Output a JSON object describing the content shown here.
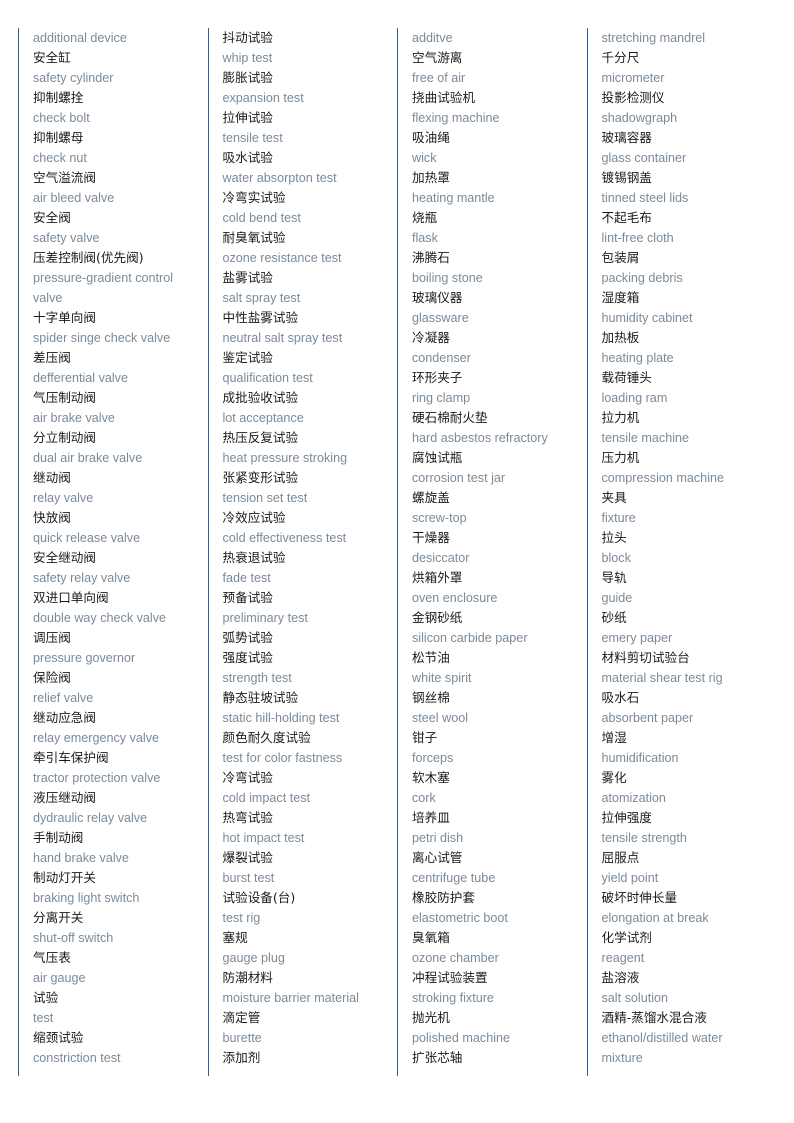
{
  "document": {
    "type": "bilingual-glossary",
    "title": "Automotive brake components and test equipment glossary",
    "language_pair": "Chinese-English",
    "column_count": 4,
    "colors": {
      "chinese_text": "#1a1a1a",
      "english_text": "#7b8a99",
      "column_rule": "#2a63a5",
      "background": "#ffffff"
    }
  },
  "columns": [
    {
      "index": 1,
      "lines": [
        {
          "lang": "en",
          "text": "additional device"
        },
        {
          "lang": "zh",
          "text": "安全缸"
        },
        {
          "lang": "en",
          "text": "safety cylinder"
        },
        {
          "lang": "zh",
          "text": "抑制螺拴"
        },
        {
          "lang": "en",
          "text": "check bolt"
        },
        {
          "lang": "zh",
          "text": "抑制螺母"
        },
        {
          "lang": "en",
          "text": "check nut"
        },
        {
          "lang": "zh",
          "text": "空气溢流阀"
        },
        {
          "lang": "en",
          "text": "air bleed valve"
        },
        {
          "lang": "zh",
          "text": "安全阀"
        },
        {
          "lang": "en",
          "text": "safety valve"
        },
        {
          "lang": "zh",
          "text": "压差控制阀(优先阀)"
        },
        {
          "lang": "en",
          "text": "pressure-gradient control"
        },
        {
          "lang": "en",
          "text": "valve"
        },
        {
          "lang": "zh",
          "text": "十字单向阀"
        },
        {
          "lang": "en",
          "text": "spider singe check valve"
        },
        {
          "lang": "zh",
          "text": "差压阀"
        },
        {
          "lang": "en",
          "text": "defferential valve"
        },
        {
          "lang": "zh",
          "text": "气压制动阀"
        },
        {
          "lang": "en",
          "text": "air brake valve"
        },
        {
          "lang": "zh",
          "text": "分立制动阀"
        },
        {
          "lang": "en",
          "text": "dual air brake valve"
        },
        {
          "lang": "zh",
          "text": "继动阀"
        },
        {
          "lang": "en",
          "text": "relay valve"
        },
        {
          "lang": "zh",
          "text": "快放阀"
        },
        {
          "lang": "en",
          "text": "quick release valve"
        },
        {
          "lang": "zh",
          "text": "安全继动阀"
        },
        {
          "lang": "en",
          "text": "safety relay valve"
        },
        {
          "lang": "zh",
          "text": "双进口单向阀"
        },
        {
          "lang": "en",
          "text": "double way check valve"
        },
        {
          "lang": "zh",
          "text": "调压阀"
        },
        {
          "lang": "en",
          "text": "pressure governor"
        },
        {
          "lang": "zh",
          "text": "保险阀"
        },
        {
          "lang": "en",
          "text": "relief valve"
        },
        {
          "lang": "zh",
          "text": "继动应急阀"
        },
        {
          "lang": "en",
          "text": "relay emergency valve"
        },
        {
          "lang": "zh",
          "text": "牵引车保护阀"
        },
        {
          "lang": "en",
          "text": "tractor protection valve"
        },
        {
          "lang": "zh",
          "text": "液压继动阀"
        },
        {
          "lang": "en",
          "text": "dydraulic relay valve"
        },
        {
          "lang": "zh",
          "text": "手制动阀"
        },
        {
          "lang": "en",
          "text": "hand brake valve"
        },
        {
          "lang": "zh",
          "text": "制动灯开关"
        },
        {
          "lang": "en",
          "text": "braking light switch"
        },
        {
          "lang": "zh",
          "text": "分离开关"
        },
        {
          "lang": "en",
          "text": "shut-off switch"
        },
        {
          "lang": "zh",
          "text": "气压表"
        },
        {
          "lang": "en",
          "text": "air gauge"
        },
        {
          "lang": "zh",
          "text": "试验"
        },
        {
          "lang": "en",
          "text": "test"
        },
        {
          "lang": "zh",
          "text": "缩颈试验"
        },
        {
          "lang": "en",
          "text": "constriction test"
        }
      ]
    },
    {
      "index": 2,
      "lines": [
        {
          "lang": "zh",
          "text": "抖动试验"
        },
        {
          "lang": "en",
          "text": "whip test"
        },
        {
          "lang": "zh",
          "text": "膨胀试验"
        },
        {
          "lang": "en",
          "text": "expansion test"
        },
        {
          "lang": "zh",
          "text": "拉伸试验"
        },
        {
          "lang": "en",
          "text": "tensile test"
        },
        {
          "lang": "zh",
          "text": "吸水试验"
        },
        {
          "lang": "en",
          "text": "water absorpton test"
        },
        {
          "lang": "zh",
          "text": "冷弯实试验"
        },
        {
          "lang": "en",
          "text": "cold bend test"
        },
        {
          "lang": "zh",
          "text": "耐臭氧试验"
        },
        {
          "lang": "en",
          "text": "ozone resistance test"
        },
        {
          "lang": "zh",
          "text": "盐雾试验"
        },
        {
          "lang": "en",
          "text": "salt spray test"
        },
        {
          "lang": "zh",
          "text": "中性盐雾试验"
        },
        {
          "lang": "en",
          "text": "neutral salt spray test"
        },
        {
          "lang": "zh",
          "text": "鉴定试验"
        },
        {
          "lang": "en",
          "text": "qualification test"
        },
        {
          "lang": "zh",
          "text": "成批验收试验"
        },
        {
          "lang": "en",
          "text": "lot acceptance"
        },
        {
          "lang": "zh",
          "text": "热压反复试验"
        },
        {
          "lang": "en",
          "text": "heat pressure stroking"
        },
        {
          "lang": "zh",
          "text": "张紧变形试验"
        },
        {
          "lang": "en",
          "text": "tension set test"
        },
        {
          "lang": "zh",
          "text": "冷效应试验"
        },
        {
          "lang": "en",
          "text": "cold effectiveness test"
        },
        {
          "lang": "zh",
          "text": "热衰退试验"
        },
        {
          "lang": "en",
          "text": "fade test"
        },
        {
          "lang": "zh",
          "text": "预备试验"
        },
        {
          "lang": "en",
          "text": "preliminary test"
        },
        {
          "lang": "zh",
          "text": "弧势试验"
        },
        {
          "lang": "zh",
          "text": "强度试验"
        },
        {
          "lang": "en",
          "text": "strength test"
        },
        {
          "lang": "zh",
          "text": "静态驻坡试验"
        },
        {
          "lang": "en",
          "text": "static hill-holding test"
        },
        {
          "lang": "zh",
          "text": "颜色耐久度试验"
        },
        {
          "lang": "en",
          "text": "test for color fastness"
        },
        {
          "lang": "zh",
          "text": "冷弯试验"
        },
        {
          "lang": "en",
          "text": "cold impact test"
        },
        {
          "lang": "zh",
          "text": "热弯试验"
        },
        {
          "lang": "en",
          "text": "hot impact test"
        },
        {
          "lang": "zh",
          "text": "爆裂试验"
        },
        {
          "lang": "en",
          "text": "burst test"
        },
        {
          "lang": "zh",
          "text": "试验设备(台)"
        },
        {
          "lang": "en",
          "text": "test rig"
        },
        {
          "lang": "zh",
          "text": "塞规"
        },
        {
          "lang": "en",
          "text": "gauge plug"
        },
        {
          "lang": "zh",
          "text": "防潮材料"
        },
        {
          "lang": "en",
          "text": "moisture barrier material"
        },
        {
          "lang": "zh",
          "text": "滴定管"
        },
        {
          "lang": "en",
          "text": "burette"
        },
        {
          "lang": "zh",
          "text": "添加剂"
        }
      ]
    },
    {
      "index": 3,
      "lines": [
        {
          "lang": "en",
          "text": "additve"
        },
        {
          "lang": "zh",
          "text": "空气游离"
        },
        {
          "lang": "en",
          "text": "free of air"
        },
        {
          "lang": "zh",
          "text": "挠曲试验机"
        },
        {
          "lang": "en",
          "text": "flexing machine"
        },
        {
          "lang": "zh",
          "text": "吸油绳"
        },
        {
          "lang": "en",
          "text": "wick"
        },
        {
          "lang": "zh",
          "text": "加热罩"
        },
        {
          "lang": "en",
          "text": "heating mantle"
        },
        {
          "lang": "zh",
          "text": "烧瓶"
        },
        {
          "lang": "en",
          "text": "flask"
        },
        {
          "lang": "zh",
          "text": "沸腾石"
        },
        {
          "lang": "en",
          "text": "boiling stone"
        },
        {
          "lang": "zh",
          "text": "玻璃仪器"
        },
        {
          "lang": "en",
          "text": "glassware"
        },
        {
          "lang": "zh",
          "text": "冷凝器"
        },
        {
          "lang": "en",
          "text": "condenser"
        },
        {
          "lang": "zh",
          "text": "环形夹子"
        },
        {
          "lang": "en",
          "text": "ring clamp"
        },
        {
          "lang": "zh",
          "text": "硬石棉耐火垫"
        },
        {
          "lang": "en",
          "text": "hard asbestos refractory"
        },
        {
          "lang": "zh",
          "text": "腐蚀试瓶"
        },
        {
          "lang": "en",
          "text": "corrosion test jar"
        },
        {
          "lang": "zh",
          "text": "螺旋盖"
        },
        {
          "lang": "en",
          "text": "screw-top"
        },
        {
          "lang": "zh",
          "text": "干燥器"
        },
        {
          "lang": "en",
          "text": "desiccator"
        },
        {
          "lang": "zh",
          "text": "烘箱外罩"
        },
        {
          "lang": "en",
          "text": "oven enclosure"
        },
        {
          "lang": "zh",
          "text": "金钢砂纸"
        },
        {
          "lang": "en",
          "text": "silicon carbide paper"
        },
        {
          "lang": "zh",
          "text": "松节油"
        },
        {
          "lang": "en",
          "text": "white spirit"
        },
        {
          "lang": "zh",
          "text": "钢丝棉"
        },
        {
          "lang": "en",
          "text": "steel wool"
        },
        {
          "lang": "zh",
          "text": "钳子"
        },
        {
          "lang": "en",
          "text": "forceps"
        },
        {
          "lang": "zh",
          "text": "软木塞"
        },
        {
          "lang": "en",
          "text": "cork"
        },
        {
          "lang": "zh",
          "text": "培养皿"
        },
        {
          "lang": "en",
          "text": "petri dish"
        },
        {
          "lang": "zh",
          "text": "离心试管"
        },
        {
          "lang": "en",
          "text": "centrifuge tube"
        },
        {
          "lang": "zh",
          "text": "橡胶防护套"
        },
        {
          "lang": "en",
          "text": "elastometric boot"
        },
        {
          "lang": "zh",
          "text": "臭氧箱"
        },
        {
          "lang": "en",
          "text": "ozone chamber"
        },
        {
          "lang": "zh",
          "text": "冲程试验装置"
        },
        {
          "lang": "en",
          "text": "stroking fixture"
        },
        {
          "lang": "zh",
          "text": "抛光机"
        },
        {
          "lang": "en",
          "text": "polished machine"
        },
        {
          "lang": "zh",
          "text": "扩张芯轴"
        }
      ]
    },
    {
      "index": 4,
      "lines": [
        {
          "lang": "en",
          "text": "stretching mandrel"
        },
        {
          "lang": "zh",
          "text": "千分尺"
        },
        {
          "lang": "en",
          "text": "micrometer"
        },
        {
          "lang": "zh",
          "text": "投影检测仪"
        },
        {
          "lang": "en",
          "text": "shadowgraph"
        },
        {
          "lang": "zh",
          "text": "玻璃容器"
        },
        {
          "lang": "en",
          "text": "glass container"
        },
        {
          "lang": "zh",
          "text": "镀锡钢盖"
        },
        {
          "lang": "en",
          "text": "tinned steel lids"
        },
        {
          "lang": "zh",
          "text": "不起毛布"
        },
        {
          "lang": "en",
          "text": "lint-free cloth"
        },
        {
          "lang": "zh",
          "text": "包装屑"
        },
        {
          "lang": "en",
          "text": "packing debris"
        },
        {
          "lang": "zh",
          "text": "湿度箱"
        },
        {
          "lang": "en",
          "text": "humidity cabinet"
        },
        {
          "lang": "zh",
          "text": "加热板"
        },
        {
          "lang": "en",
          "text": "heating plate"
        },
        {
          "lang": "zh",
          "text": "载荷锤头"
        },
        {
          "lang": "en",
          "text": "loading ram"
        },
        {
          "lang": "zh",
          "text": "拉力机"
        },
        {
          "lang": "en",
          "text": "tensile machine"
        },
        {
          "lang": "zh",
          "text": "压力机"
        },
        {
          "lang": "en",
          "text": "compression machine"
        },
        {
          "lang": "zh",
          "text": "夹具"
        },
        {
          "lang": "en",
          "text": "fixture"
        },
        {
          "lang": "zh",
          "text": "拉头"
        },
        {
          "lang": "en",
          "text": "block"
        },
        {
          "lang": "zh",
          "text": "导轨"
        },
        {
          "lang": "en",
          "text": "guide"
        },
        {
          "lang": "zh",
          "text": "砂纸"
        },
        {
          "lang": "en",
          "text": "emery paper"
        },
        {
          "lang": "zh",
          "text": "材料剪切试验台"
        },
        {
          "lang": "en",
          "text": "material shear test rig"
        },
        {
          "lang": "zh",
          "text": "吸水石"
        },
        {
          "lang": "en",
          "text": "absorbent paper"
        },
        {
          "lang": "zh",
          "text": "增湿"
        },
        {
          "lang": "en",
          "text": "humidification"
        },
        {
          "lang": "zh",
          "text": "雾化"
        },
        {
          "lang": "en",
          "text": "atomization"
        },
        {
          "lang": "zh",
          "text": "拉伸强度"
        },
        {
          "lang": "en",
          "text": "tensile strength"
        },
        {
          "lang": "zh",
          "text": "屈服点"
        },
        {
          "lang": "en",
          "text": "yield point"
        },
        {
          "lang": "zh",
          "text": "破坏时伸长量"
        },
        {
          "lang": "en",
          "text": "elongation at break"
        },
        {
          "lang": "zh",
          "text": "化学试剂"
        },
        {
          "lang": "en",
          "text": "reagent"
        },
        {
          "lang": "zh",
          "text": "盐溶液"
        },
        {
          "lang": "en",
          "text": "salt solution"
        },
        {
          "lang": "zh",
          "text": "酒精-蒸馏水混合液"
        },
        {
          "lang": "en",
          "text": "ethanol/distilled water"
        },
        {
          "lang": "en",
          "text": "mixture"
        }
      ]
    }
  ]
}
